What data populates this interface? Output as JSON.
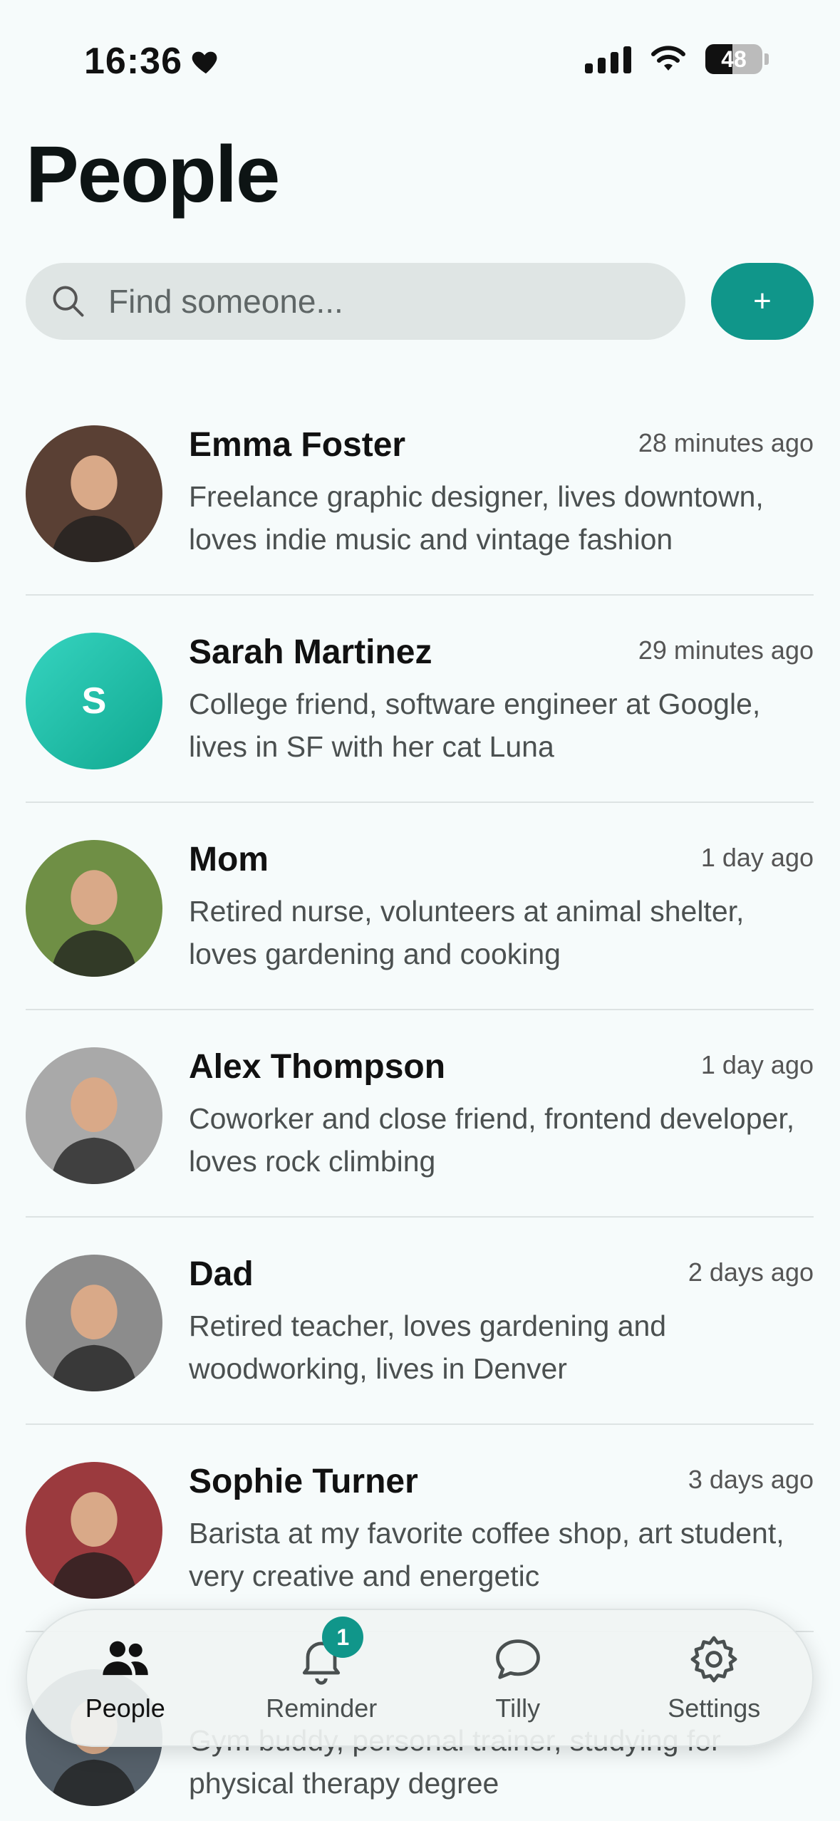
{
  "status_bar": {
    "time": "16:36",
    "battery": "48",
    "battery_level": 0.48
  },
  "title": "People",
  "search": {
    "placeholder": "Find someone..."
  },
  "add_button": {
    "label": "+"
  },
  "people": [
    {
      "name": "Emma Foster",
      "time": "28 minutes ago",
      "description": "Freelance graphic designer, lives downtown, loves indie music and vintage fashion",
      "avatar": "photo",
      "avatar_color": "#5a4034"
    },
    {
      "name": "Sarah Martinez",
      "time": "29 minutes ago",
      "description": "College friend, software engineer at Google, lives in SF with her cat Luna",
      "avatar": "letter",
      "initial": "S"
    },
    {
      "name": "Mom",
      "time": "1 day ago",
      "description": "Retired nurse, volunteers at animal shelter, loves gardening and cooking",
      "avatar": "photo",
      "avatar_color": "#6f8f45"
    },
    {
      "name": "Alex Thompson",
      "time": "1 day ago",
      "description": "Coworker and close friend, frontend developer, loves rock climbing",
      "avatar": "photo",
      "avatar_color": "#a9a9a9"
    },
    {
      "name": "Dad",
      "time": "2 days ago",
      "description": "Retired teacher, loves gardening and woodworking, lives in Denver",
      "avatar": "photo",
      "avatar_color": "#8c8c8c"
    },
    {
      "name": "Sophie Turner",
      "time": "3 days ago",
      "description": "Barista at my favorite coffee shop, art student, very creative and energetic",
      "avatar": "photo",
      "avatar_color": "#9b3a3e"
    },
    {
      "name": "",
      "time": "",
      "description": "Gym buddy, personal trainer, studying for physical therapy degree",
      "avatar": "photo",
      "avatar_color": "#55606a"
    }
  ],
  "tabs": [
    {
      "label": "People",
      "icon": "people-icon",
      "active": true
    },
    {
      "label": "Reminder",
      "icon": "bell-icon",
      "badge": "1"
    },
    {
      "label": "Tilly",
      "icon": "chat-bubble-icon"
    },
    {
      "label": "Settings",
      "icon": "gear-icon"
    }
  ]
}
